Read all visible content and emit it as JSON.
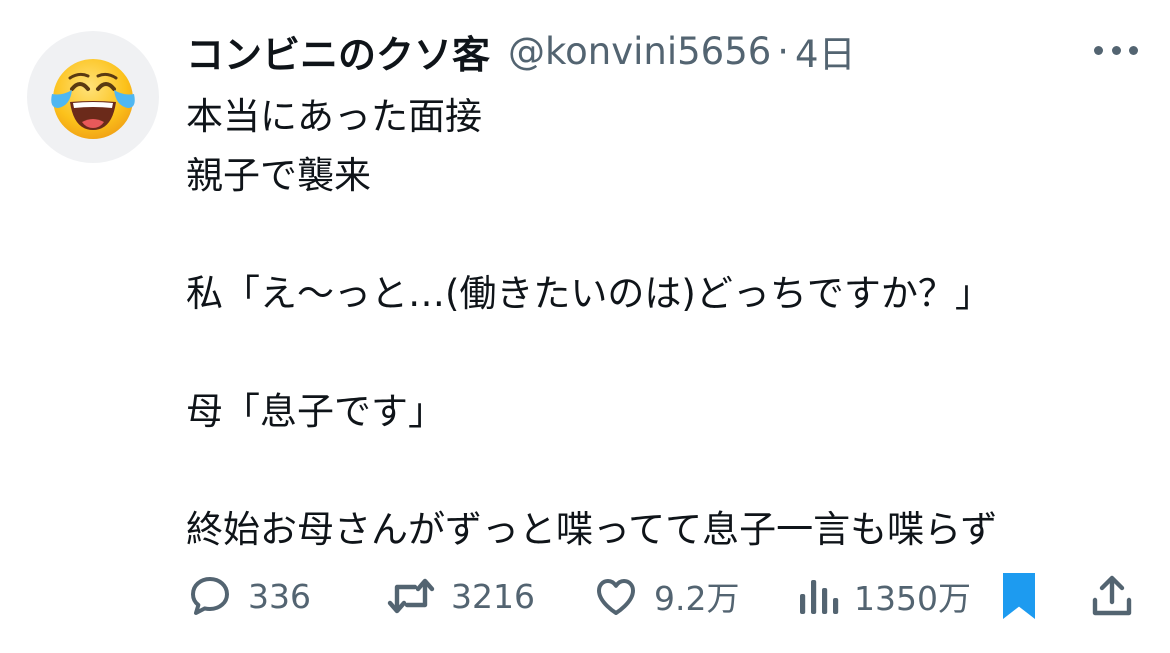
{
  "tweet": {
    "display_name": "コンビニのクソ客",
    "handle": "@konvini5656",
    "separator": "·",
    "time": "4日",
    "lines": [
      "本当にあった面接",
      "親子で襲来",
      "",
      "私「え〜っと…(働きたいのは)どっちですか？」",
      "",
      "母「息子です」",
      "",
      "終始お母さんがずっと喋ってて息子一言も喋らず"
    ]
  },
  "actions": {
    "replies": "336",
    "reposts": "3216",
    "likes": "9.2万",
    "views": "1350万"
  },
  "icons": {
    "avatar": "tears-of-joy-emoji",
    "reply": "speech-bubble-icon",
    "repost": "repost-arrows-icon",
    "like": "heart-icon",
    "views": "bar-chart-icon",
    "bookmark": "bookmark-filled-icon",
    "share": "share-upload-icon",
    "more": "more-dots-icon"
  },
  "colors": {
    "text": "#0f1419",
    "secondary": "#536471",
    "bookmark": "#1d9bf0",
    "avatar_bg": "#f0f1f3"
  }
}
